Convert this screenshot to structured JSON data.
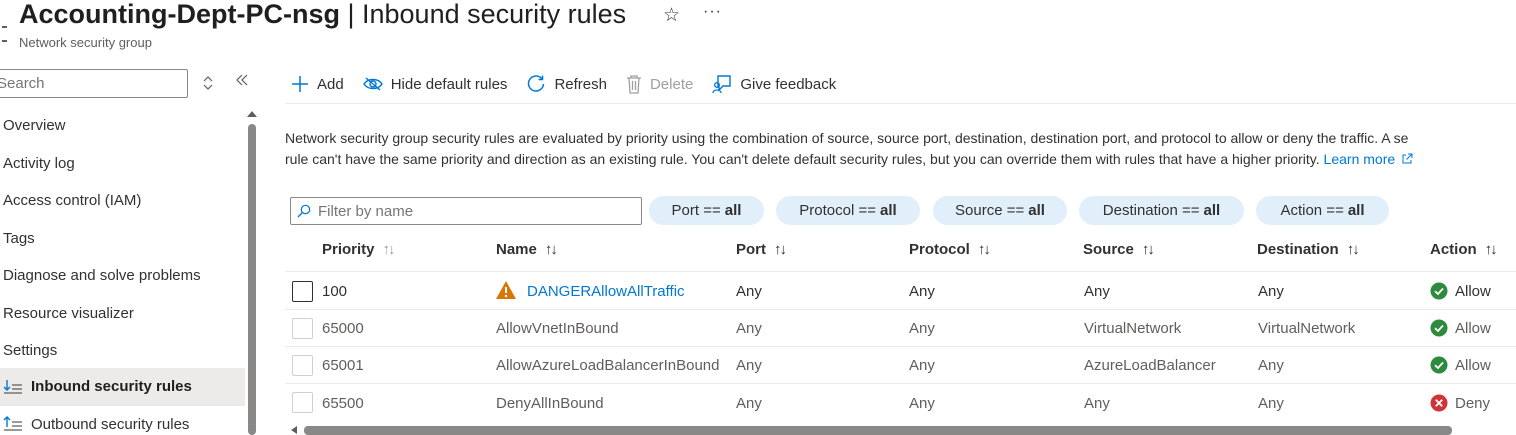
{
  "header": {
    "resource_name": "Accounting-Dept-PC-nsg",
    "separator": " | ",
    "blade_title": "Inbound security rules",
    "subtitle": "Network security group",
    "star_glyph": "☆",
    "more_glyph": "···"
  },
  "sidebar": {
    "search_placeholder": "Search",
    "items": [
      {
        "label": "Overview"
      },
      {
        "label": "Activity log"
      },
      {
        "label": "Access control (IAM)"
      },
      {
        "label": "Tags"
      },
      {
        "label": "Diagnose and solve problems"
      },
      {
        "label": "Resource visualizer"
      },
      {
        "label": "Settings"
      },
      {
        "label": "Inbound security rules"
      },
      {
        "label": "Outbound security rules"
      }
    ]
  },
  "toolbar": {
    "add": "Add",
    "hide_default": "Hide default rules",
    "refresh": "Refresh",
    "delete": "Delete",
    "feedback": "Give feedback"
  },
  "description": {
    "line1": "Network security group security rules are evaluated by priority using the combination of source, source port, destination, destination port, and protocol to allow or deny the traffic. A se",
    "line2": "rule can't have the same priority and direction as an existing rule. You can't delete default security rules, but you can override them with rules that have a higher priority.",
    "learn_more": "Learn more"
  },
  "filters": {
    "name_placeholder": "Filter by name",
    "pills": [
      {
        "label": "Port ==",
        "value": "all"
      },
      {
        "label": "Protocol ==",
        "value": "all"
      },
      {
        "label": "Source ==",
        "value": "all"
      },
      {
        "label": "Destination ==",
        "value": "all"
      },
      {
        "label": "Action ==",
        "value": "all"
      }
    ]
  },
  "table": {
    "columns": [
      "Priority",
      "Name",
      "Port",
      "Protocol",
      "Source",
      "Destination",
      "Action"
    ],
    "sort_glyph": "↑↓",
    "rows": [
      {
        "priority": "100",
        "name": "DANGERAllowAllTraffic",
        "port": "Any",
        "protocol": "Any",
        "source": "Any",
        "destination": "Any",
        "action": "Allow"
      },
      {
        "priority": "65000",
        "name": "AllowVnetInBound",
        "port": "Any",
        "protocol": "Any",
        "source": "VirtualNetwork",
        "destination": "VirtualNetwork",
        "action": "Allow"
      },
      {
        "priority": "65001",
        "name": "AllowAzureLoadBalancerInBound",
        "port": "Any",
        "protocol": "Any",
        "source": "AzureLoadBalancer",
        "destination": "Any",
        "action": "Allow"
      },
      {
        "priority": "65500",
        "name": "DenyAllInBound",
        "port": "Any",
        "protocol": "Any",
        "source": "Any",
        "destination": "Any",
        "action": "Deny"
      }
    ]
  },
  "colors": {
    "accent": "#0078d4",
    "allow": "#2e8b3d",
    "deny": "#d13438",
    "warning": "#d97706"
  }
}
